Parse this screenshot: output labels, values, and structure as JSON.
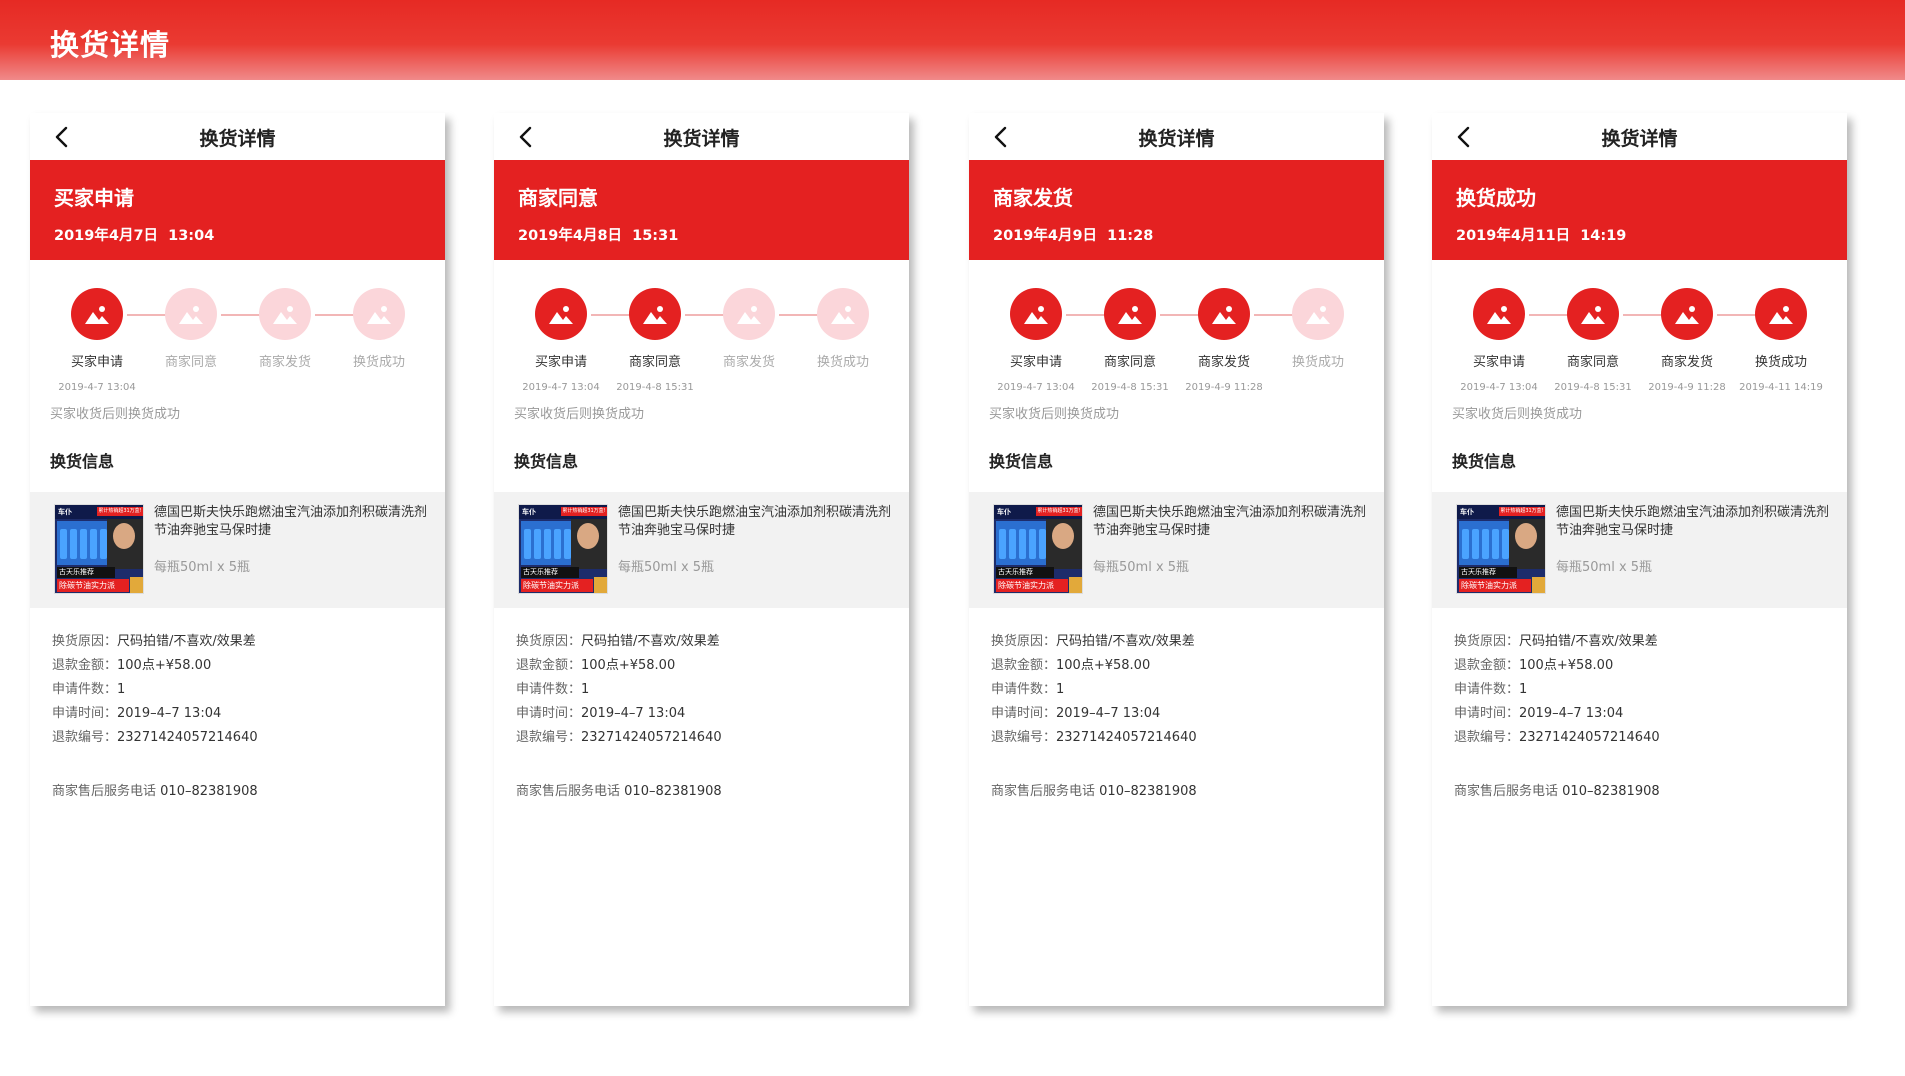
{
  "page_title": "换货详情",
  "colors": {
    "accent": "#e42121",
    "step_inactive": "#fbd6da",
    "line": "#f2b6b6"
  },
  "screens": [
    {
      "nav_title": "换货详情",
      "status_title": "买家申请",
      "status_time": "2019年4月7日  13:04",
      "steps": [
        {
          "label": "买家申请",
          "time": "2019-4-7 13:04",
          "done": true
        },
        {
          "label": "商家同意",
          "time": "",
          "done": false
        },
        {
          "label": "商家发货",
          "time": "",
          "done": false
        },
        {
          "label": "换货成功",
          "time": "",
          "done": false
        }
      ],
      "note": "买家收货后则换货成功",
      "section_title": "换货信息",
      "product": {
        "name": "德国巴斯夫快乐跑燃油宝汽油添加剂积碳清洗剂节油奔驰宝马保时捷",
        "spec": "每瓶50ml x 5瓶",
        "img_logo": "车仆",
        "img_banner": "累计热销超31万盒!",
        "img_tag1": "古天乐推荐",
        "img_tag2": "除碳节油实力派"
      },
      "details": [
        {
          "k": "换货原因：",
          "v": "尺码拍错/不喜欢/效果差"
        },
        {
          "k": "退款金额：",
          "v": "100点+¥58.00"
        },
        {
          "k": "申请件数：",
          "v": "1"
        },
        {
          "k": "申请时间：",
          "v": "2019–4–7 13:04"
        },
        {
          "k": "退款编号：",
          "v": "23271424057214640"
        }
      ],
      "service_label": "商家售后服务电话",
      "service_phone": "010–82381908"
    },
    {
      "nav_title": "换货详情",
      "status_title": "商家同意",
      "status_time": "2019年4月8日  15:31",
      "steps": [
        {
          "label": "买家申请",
          "time": "2019-4-7 13:04",
          "done": true
        },
        {
          "label": "商家同意",
          "time": "2019-4-8 15:31",
          "done": true
        },
        {
          "label": "商家发货",
          "time": "",
          "done": false
        },
        {
          "label": "换货成功",
          "time": "",
          "done": false
        }
      ],
      "note": "买家收货后则换货成功",
      "section_title": "换货信息",
      "product": {
        "name": "德国巴斯夫快乐跑燃油宝汽油添加剂积碳清洗剂节油奔驰宝马保时捷",
        "spec": "每瓶50ml x 5瓶",
        "img_logo": "车仆",
        "img_banner": "累计热销超31万盒!",
        "img_tag1": "古天乐推荐",
        "img_tag2": "除碳节油实力派"
      },
      "details": [
        {
          "k": "换货原因：",
          "v": "尺码拍错/不喜欢/效果差"
        },
        {
          "k": "退款金额：",
          "v": "100点+¥58.00"
        },
        {
          "k": "申请件数：",
          "v": "1"
        },
        {
          "k": "申请时间：",
          "v": "2019–4–7 13:04"
        },
        {
          "k": "退款编号：",
          "v": "23271424057214640"
        }
      ],
      "service_label": "商家售后服务电话",
      "service_phone": "010–82381908"
    },
    {
      "nav_title": "换货详情",
      "status_title": "商家发货",
      "status_time": "2019年4月9日  11:28",
      "steps": [
        {
          "label": "买家申请",
          "time": "2019-4-7 13:04",
          "done": true
        },
        {
          "label": "商家同意",
          "time": "2019-4-8 15:31",
          "done": true
        },
        {
          "label": "商家发货",
          "time": "2019-4-9 11:28",
          "done": true
        },
        {
          "label": "换货成功",
          "time": "",
          "done": false
        }
      ],
      "note": "买家收货后则换货成功",
      "section_title": "换货信息",
      "product": {
        "name": "德国巴斯夫快乐跑燃油宝汽油添加剂积碳清洗剂节油奔驰宝马保时捷",
        "spec": "每瓶50ml x 5瓶",
        "img_logo": "车仆",
        "img_banner": "累计热销超31万盒!",
        "img_tag1": "古天乐推荐",
        "img_tag2": "除碳节油实力派"
      },
      "details": [
        {
          "k": "换货原因：",
          "v": "尺码拍错/不喜欢/效果差"
        },
        {
          "k": "退款金额：",
          "v": "100点+¥58.00"
        },
        {
          "k": "申请件数：",
          "v": "1"
        },
        {
          "k": "申请时间：",
          "v": "2019–4–7 13:04"
        },
        {
          "k": "退款编号：",
          "v": "23271424057214640"
        }
      ],
      "service_label": "商家售后服务电话",
      "service_phone": "010–82381908"
    },
    {
      "nav_title": "换货详情",
      "status_title": "换货成功",
      "status_time": "2019年4月11日  14:19",
      "steps": [
        {
          "label": "买家申请",
          "time": "2019-4-7 13:04",
          "done": true
        },
        {
          "label": "商家同意",
          "time": "2019-4-8 15:31",
          "done": true
        },
        {
          "label": "商家发货",
          "time": "2019-4-9 11:28",
          "done": true
        },
        {
          "label": "换货成功",
          "time": "2019-4-11 14:19",
          "done": true
        }
      ],
      "note": "买家收货后则换货成功",
      "section_title": "换货信息",
      "product": {
        "name": "德国巴斯夫快乐跑燃油宝汽油添加剂积碳清洗剂节油奔驰宝马保时捷",
        "spec": "每瓶50ml x 5瓶",
        "img_logo": "车仆",
        "img_banner": "累计热销超31万盒!",
        "img_tag1": "古天乐推荐",
        "img_tag2": "除碳节油实力派"
      },
      "details": [
        {
          "k": "换货原因：",
          "v": "尺码拍错/不喜欢/效果差"
        },
        {
          "k": "退款金额：",
          "v": "100点+¥58.00"
        },
        {
          "k": "申请件数：",
          "v": "1"
        },
        {
          "k": "申请时间：",
          "v": "2019–4–7 13:04"
        },
        {
          "k": "退款编号：",
          "v": "23271424057214640"
        }
      ],
      "service_label": "商家售后服务电话",
      "service_phone": "010–82381908"
    }
  ]
}
